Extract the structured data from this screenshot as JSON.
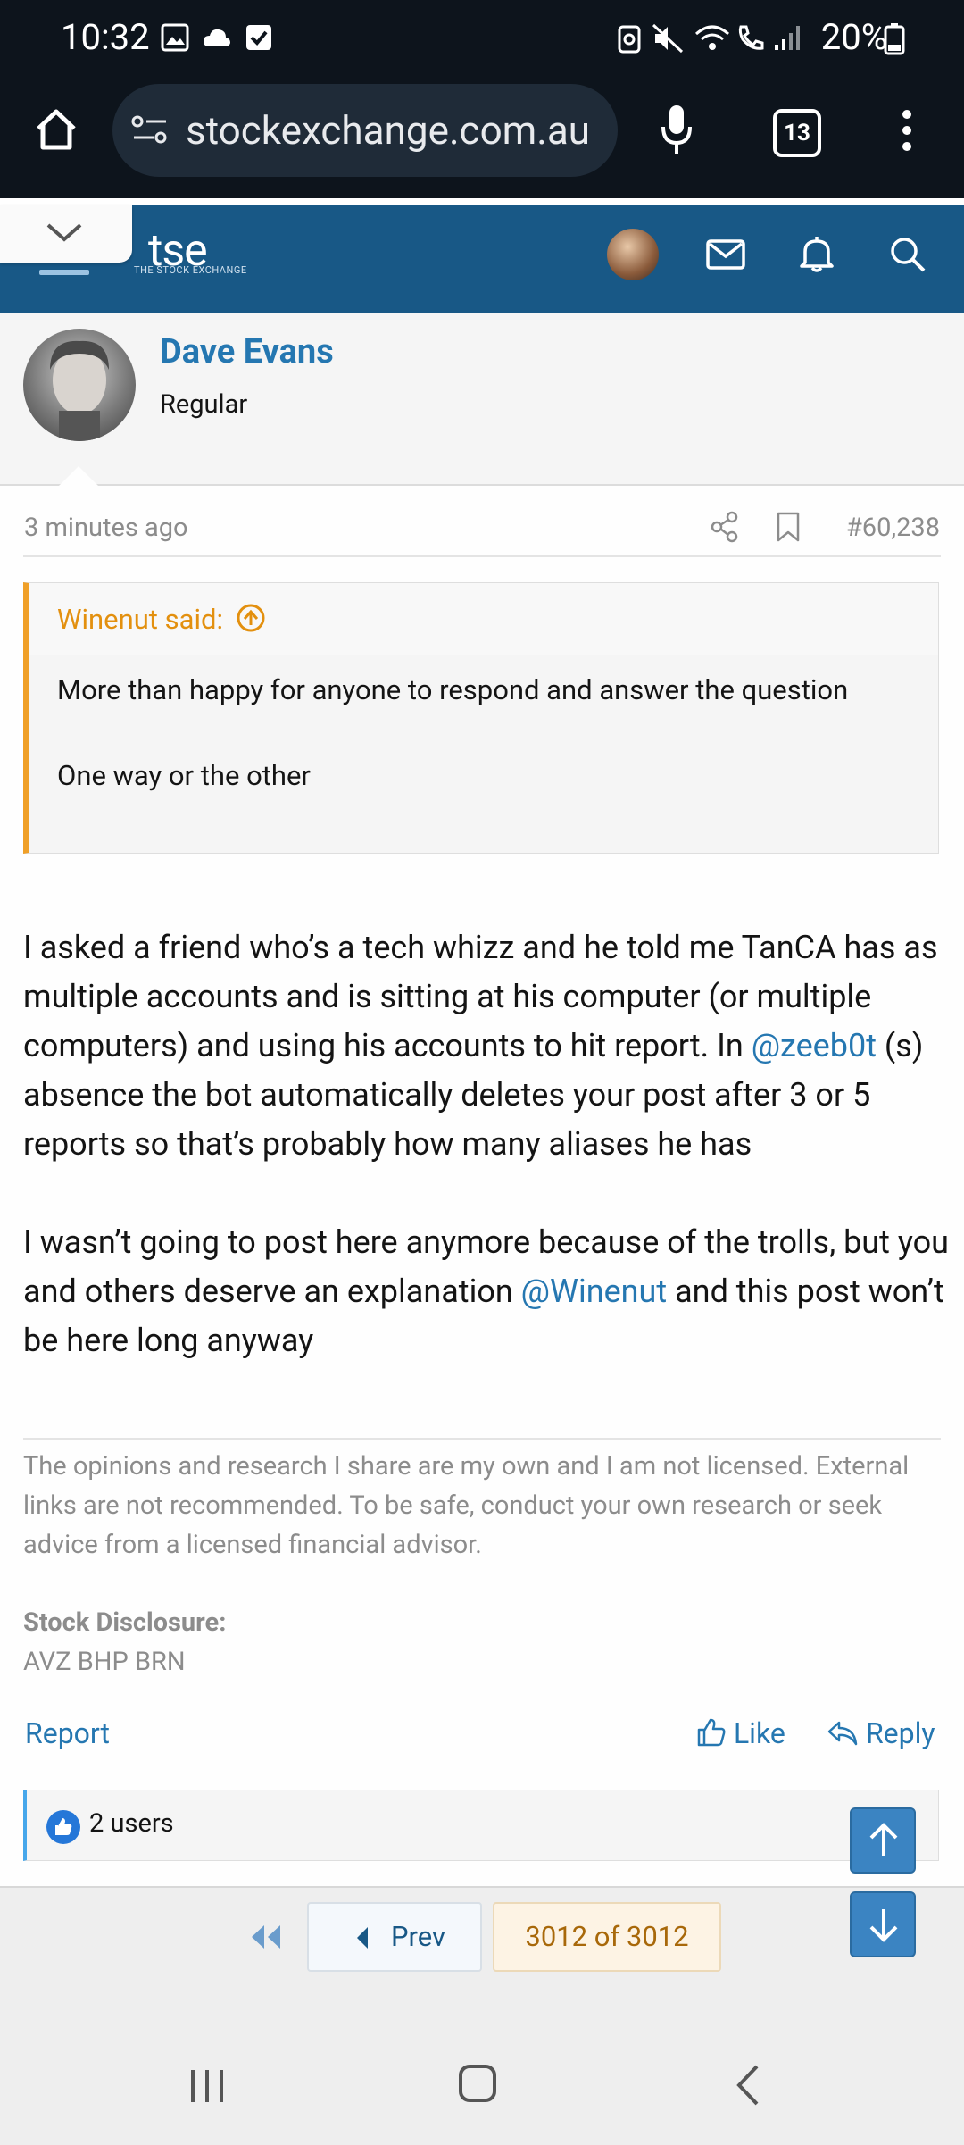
{
  "status_bar": {
    "time": "10:32",
    "battery": "20%"
  },
  "browser": {
    "url": "stockexchange.com.au",
    "tab_count": "13"
  },
  "site": {
    "logo_text": "tse",
    "logo_sub": "THE STOCK EXCHANGE"
  },
  "author": {
    "name": "Dave Evans",
    "role": "Regular"
  },
  "post": {
    "time": "3 minutes ago",
    "number": "#60,238",
    "quote": {
      "author": "Winenut said:",
      "line1": "More than happy for anyone to respond and answer the question",
      "line2": "One way or the other"
    },
    "para1_a": "I asked a friend who’s a tech whizz and he told me TanCA has as multiple accounts and is sitting at his computer (or multiple computers) and using his accounts to hit report. In ",
    "para1_mention": "@zeeb0t",
    "para1_b": " (s) absence the bot automatically deletes your post after 3 or 5 reports so that’s probably how many aliases he has",
    "para2_a": "I wasn’t going to post here anymore because of the trolls, but you and others deserve an explanation ",
    "para2_mention": "@Winenut",
    "para2_b": " and this post won’t be here long anyway",
    "signature": "The opinions and research I share are my own and I am not licensed. External links are not recommended. To be safe, conduct your own research or seek advice from a licensed financial advisor.",
    "disclosure_label": "Stock Disclosure:",
    "disclosure_value": "AVZ BHP BRN",
    "report_label": "Report",
    "like_label": "Like",
    "reply_label": "Reply",
    "reactions_text": "2 users"
  },
  "pagination": {
    "prev_label": "Prev",
    "current": "3012 of 3012"
  }
}
